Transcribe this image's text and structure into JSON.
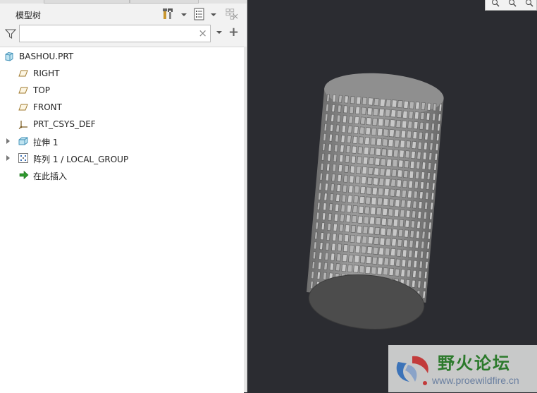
{
  "model_tree": {
    "title": "模型树",
    "search": {
      "value": "",
      "clear_symbol": "×"
    },
    "add_symbol": "+",
    "items": [
      {
        "label": "BASHOU.PRT",
        "icon": "part-icon",
        "expandable": false
      },
      {
        "label": "RIGHT",
        "icon": "datum-plane-icon",
        "expandable": false
      },
      {
        "label": "TOP",
        "icon": "datum-plane-icon",
        "expandable": false
      },
      {
        "label": "FRONT",
        "icon": "datum-plane-icon",
        "expandable": false
      },
      {
        "label": "PRT_CSYS_DEF",
        "icon": "coordinate-system-icon",
        "expandable": false
      },
      {
        "label": "拉伸 1",
        "icon": "extrude-icon",
        "expandable": true
      },
      {
        "label": "阵列 1 / LOCAL_GROUP",
        "icon": "pattern-icon",
        "expandable": true
      },
      {
        "label": "在此插入",
        "icon": "insert-here-arrow-icon",
        "expandable": false
      }
    ]
  },
  "viewport": {
    "background": "#2b2c31",
    "model_color": "#8a8a8a"
  },
  "watermark": {
    "title": "野火论坛",
    "url": "www.proewildfire.cn"
  }
}
